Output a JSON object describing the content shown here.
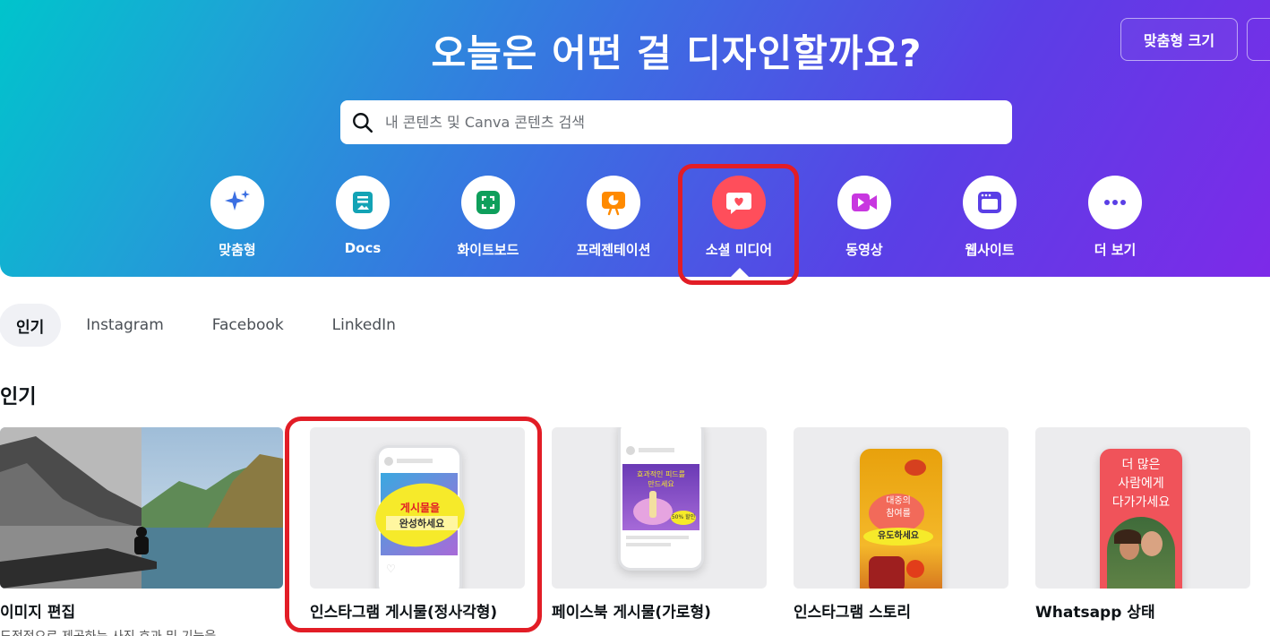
{
  "hero": {
    "title": "오늘은 어떤 걸 디자인할까요?",
    "custom_size_label": "맞춤형 크기",
    "search_placeholder": "내 콘텐츠 및 Canva 콘텐츠 검색"
  },
  "categories": [
    {
      "label": "맞춤형",
      "icon": "sparkle-icon",
      "color": "#3b6fe2"
    },
    {
      "label": "Docs",
      "icon": "docs-icon",
      "color": "#13a3b5"
    },
    {
      "label": "화이트보드",
      "icon": "whiteboard-icon",
      "color": "#0e9f5b"
    },
    {
      "label": "프레젠테이션",
      "icon": "presentation-icon",
      "color": "#ff8a00"
    },
    {
      "label": "소셜 미디어",
      "icon": "heart-chat-icon",
      "color": "#ff4e5b",
      "active": true
    },
    {
      "label": "동영상",
      "icon": "video-icon",
      "color": "#c837e0"
    },
    {
      "label": "웹사이트",
      "icon": "website-icon",
      "color": "#5a3fe6"
    },
    {
      "label": "더 보기",
      "icon": "more-icon",
      "color": "#5a3fe6"
    }
  ],
  "tabs": [
    "인기",
    "Instagram",
    "Facebook",
    "LinkedIn"
  ],
  "section_title": "인기",
  "cards": [
    {
      "title": "이미지 편집",
      "subtitle": "도전적으로 제공하는 사진 효과 및 기능을"
    },
    {
      "title": "인스타그램 게시물(정사각형)",
      "overlay_line1": "게시물을",
      "overlay_line2": "완성하세요"
    },
    {
      "title": "페이스북 게시물(가로형)",
      "overlay_line1": "효과적인 피드를",
      "overlay_line2": "만드세요",
      "badge": "50% 할인"
    },
    {
      "title": "인스타그램 스토리",
      "overlay_line1": "대중의",
      "overlay_line2": "참여를",
      "overlay_line3": "유도하세요"
    },
    {
      "title": "Whatsapp 상태",
      "overlay_line1": "더 많은",
      "overlay_line2": "사람에게",
      "overlay_line3": "다가가세요"
    }
  ]
}
